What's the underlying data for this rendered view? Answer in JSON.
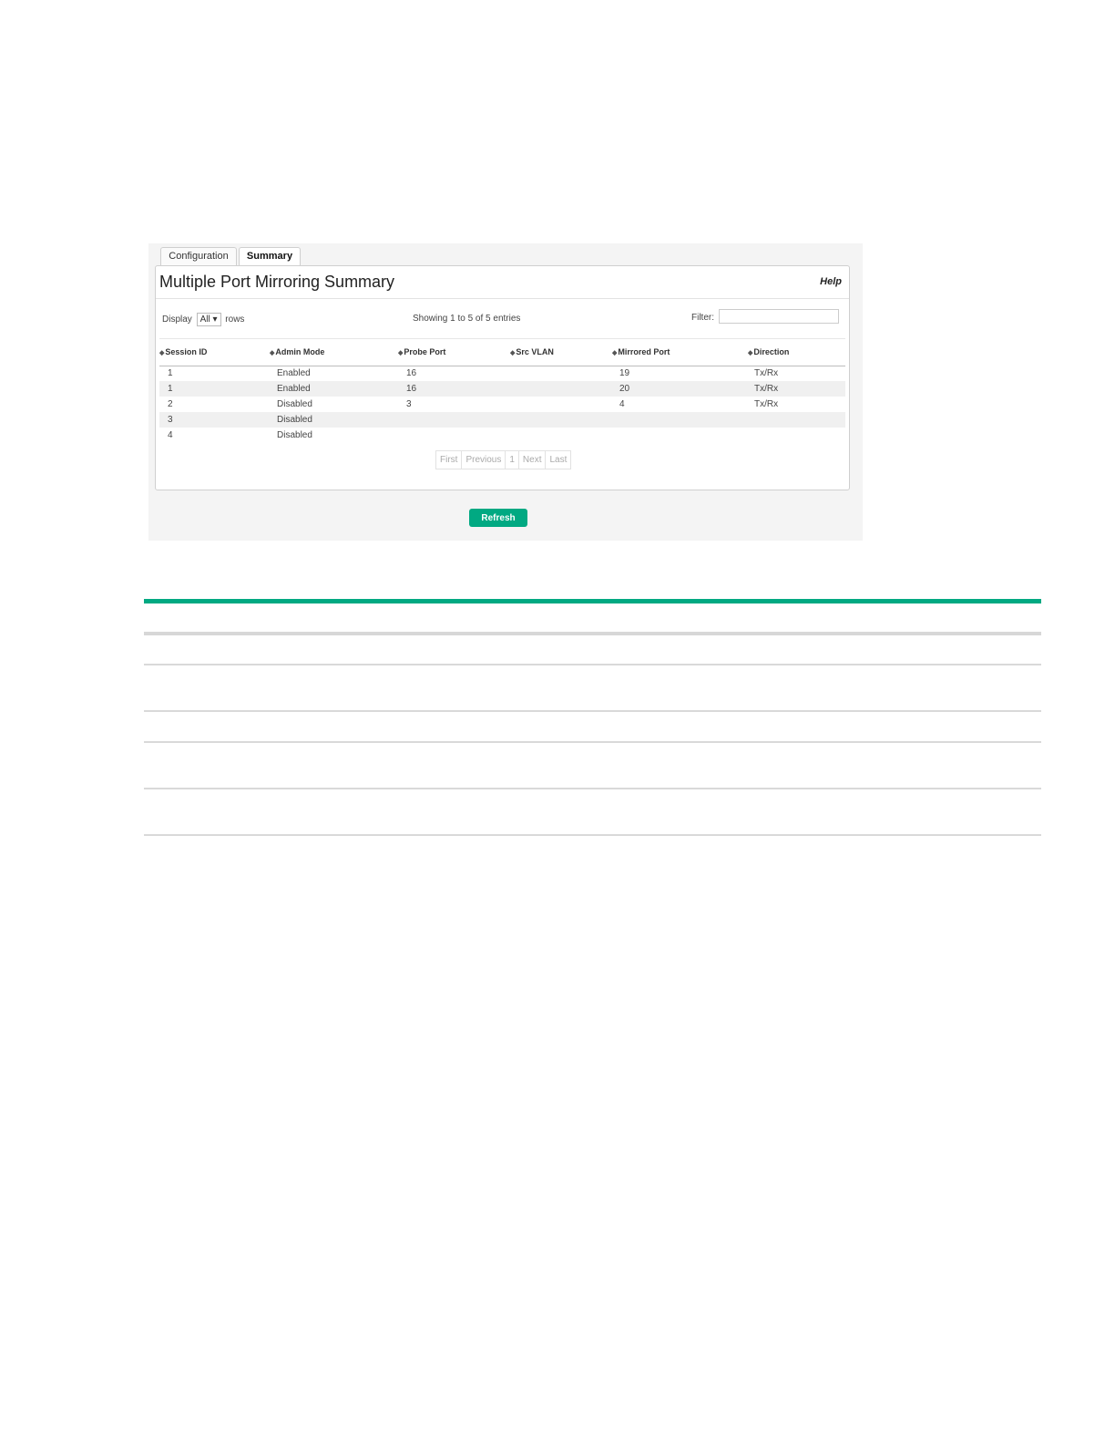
{
  "tabs": [
    {
      "label": "Configuration"
    },
    {
      "label": "Summary"
    }
  ],
  "panel": {
    "title": "Multiple Port Mirroring Summary",
    "help_label": "Help"
  },
  "controls": {
    "display_label": "Display",
    "display_value": "All",
    "rows_label": "rows",
    "showing_text": "Showing 1 to 5 of 5 entries",
    "filter_label": "Filter:",
    "filter_value": ""
  },
  "table": {
    "columns": [
      "Session ID",
      "Admin Mode",
      "Probe Port",
      "Src VLAN",
      "Mirrored Port",
      "Direction"
    ],
    "rows": [
      [
        "1",
        "Enabled",
        "16",
        "",
        "19",
        "Tx/Rx"
      ],
      [
        "1",
        "Enabled",
        "16",
        "",
        "20",
        "Tx/Rx"
      ],
      [
        "2",
        "Disabled",
        "3",
        "",
        "4",
        "Tx/Rx"
      ],
      [
        "3",
        "Disabled",
        "",
        "",
        "",
        ""
      ],
      [
        "4",
        "Disabled",
        "",
        "",
        "",
        ""
      ]
    ]
  },
  "pagination": {
    "first": "First",
    "previous": "Previous",
    "page": "1",
    "next": "Next",
    "last": "Last"
  },
  "refresh_label": "Refresh",
  "colors": {
    "accent": "#01a982"
  }
}
